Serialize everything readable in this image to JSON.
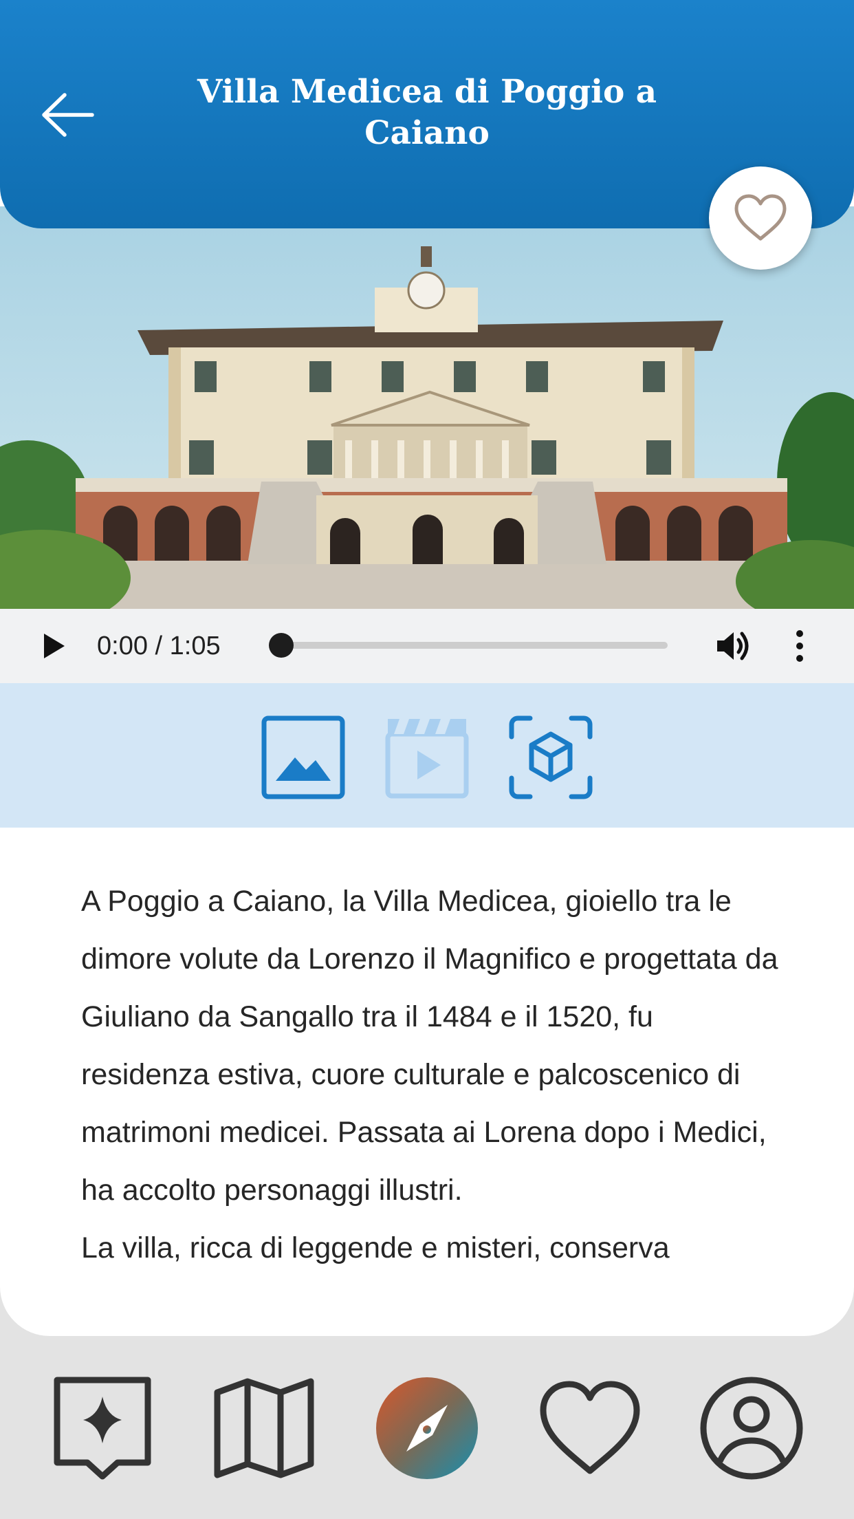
{
  "header": {
    "title": "Villa Medicea di Poggio a Caiano",
    "back_icon": "arrow-left-icon",
    "favorite_icon": "heart-outline-icon"
  },
  "player": {
    "time": "0:00 / 1:05",
    "progress": 0,
    "buffered": 0.05,
    "play_icon": "play-icon",
    "volume_icon": "volume-icon",
    "more_icon": "more-vertical-icon"
  },
  "media_tabs": [
    {
      "name": "photos",
      "icon": "image-icon",
      "active": true
    },
    {
      "name": "video",
      "icon": "video-clapper-icon",
      "active": false
    },
    {
      "name": "3d",
      "icon": "cube-3d-icon",
      "active": true
    }
  ],
  "description": {
    "paragraphs": [
      "A Poggio a Caiano, la Villa Medicea, gioiello tra le dimore volute da Lorenzo il Magnifico e progettata da Giuliano da Sangallo tra il 1484 e il 1520, fu residenza estiva, cuore culturale e palcoscenico di matrimoni medicei. Passata ai Lorena dopo i Medici, ha accolto personaggi illustri.",
      "La villa, ricca di leggende e misteri, conserva"
    ]
  },
  "nav": [
    {
      "name": "highlights",
      "icon": "sparkle-chat-icon"
    },
    {
      "name": "map",
      "icon": "map-icon"
    },
    {
      "name": "explore",
      "icon": "compass-icon",
      "active": true
    },
    {
      "name": "favorites",
      "icon": "heart-icon"
    },
    {
      "name": "profile",
      "icon": "user-circle-icon"
    }
  ],
  "colors": {
    "header": "#1779c2",
    "media_bar": "#d3e6f6",
    "accent": "#1a7cc7",
    "nav_icon": "#333333",
    "fav_heart": "#a89486"
  }
}
